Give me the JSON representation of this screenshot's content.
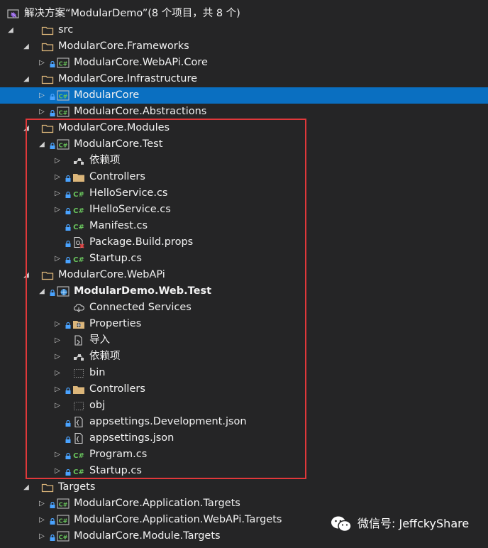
{
  "tree": {
    "items": [
      {
        "label": "解决方案“ModularDemo”(8 个项目，共 8 个)",
        "icon": "solution-icon",
        "arrow": "none",
        "depth": 0
      },
      {
        "label": "src",
        "icon": "folder-outline-icon",
        "arrow": "expanded",
        "depth": 1
      },
      {
        "label": "ModularCore.Frameworks",
        "icon": "folder-outline-icon",
        "arrow": "expanded",
        "depth": 2
      },
      {
        "label": "ModularCore.WebAPi.Core",
        "icon": "csharp-project-icon",
        "arrow": "collapsed",
        "depth": 3,
        "lock": true
      },
      {
        "label": "ModularCore.Infrastructure",
        "icon": "folder-outline-icon",
        "arrow": "expanded",
        "depth": 2
      },
      {
        "label": "ModularCore",
        "icon": "csharp-project-icon",
        "arrow": "collapsed",
        "depth": 3,
        "lock": true,
        "selected": true
      },
      {
        "label": "ModularCore.Abstractions",
        "icon": "csharp-project-icon",
        "arrow": "collapsed",
        "depth": 3,
        "lock": true
      },
      {
        "label": "ModularCore.Modules",
        "icon": "folder-outline-icon",
        "arrow": "expanded",
        "depth": 2
      },
      {
        "label": "ModularCore.Test",
        "icon": "csharp-project-icon",
        "arrow": "expanded",
        "depth": 3,
        "lock": true
      },
      {
        "label": "依赖项",
        "icon": "dependencies-icon",
        "arrow": "collapsed",
        "depth": 4
      },
      {
        "label": "Controllers",
        "icon": "folder-icon",
        "arrow": "collapsed",
        "depth": 4,
        "lock": true
      },
      {
        "label": "HelloService.cs",
        "icon": "csharp-file-icon",
        "arrow": "collapsed",
        "depth": 4,
        "lock": true
      },
      {
        "label": "IHelloService.cs",
        "icon": "csharp-file-icon",
        "arrow": "collapsed",
        "depth": 4,
        "lock": true
      },
      {
        "label": "Manifest.cs",
        "icon": "csharp-file-icon",
        "arrow": "none",
        "depth": 4,
        "lock": true
      },
      {
        "label": "Package.Build.props",
        "icon": "props-file-icon",
        "arrow": "none",
        "depth": 4,
        "lock": true
      },
      {
        "label": "Startup.cs",
        "icon": "csharp-file-icon",
        "arrow": "collapsed",
        "depth": 4,
        "lock": true
      },
      {
        "label": "ModularCore.WebAPi",
        "icon": "folder-outline-icon",
        "arrow": "expanded",
        "depth": 2
      },
      {
        "label": "ModularDemo.Web.Test",
        "icon": "web-project-icon",
        "arrow": "expanded",
        "depth": 3,
        "lock": true,
        "bold": true
      },
      {
        "label": "Connected Services",
        "icon": "connected-services-icon",
        "arrow": "none",
        "depth": 4
      },
      {
        "label": "Properties",
        "icon": "properties-folder-icon",
        "arrow": "collapsed",
        "depth": 4,
        "lock": true
      },
      {
        "label": "导入",
        "icon": "import-icon",
        "arrow": "collapsed",
        "depth": 4
      },
      {
        "label": "依赖项",
        "icon": "dependencies-icon",
        "arrow": "collapsed",
        "depth": 4
      },
      {
        "label": "bin",
        "icon": "dotted-folder-icon",
        "arrow": "collapsed",
        "depth": 4
      },
      {
        "label": "Controllers",
        "icon": "folder-icon",
        "arrow": "collapsed",
        "depth": 4,
        "lock": true
      },
      {
        "label": "obj",
        "icon": "dotted-folder-icon",
        "arrow": "collapsed",
        "depth": 4
      },
      {
        "label": "appsettings.Development.json",
        "icon": "json-file-icon",
        "arrow": "none",
        "depth": 4,
        "lock": true
      },
      {
        "label": "appsettings.json",
        "icon": "json-file-icon",
        "arrow": "none",
        "depth": 4,
        "lock": true
      },
      {
        "label": "Program.cs",
        "icon": "csharp-file-icon",
        "arrow": "collapsed",
        "depth": 4,
        "lock": true
      },
      {
        "label": "Startup.cs",
        "icon": "csharp-file-icon",
        "arrow": "collapsed",
        "depth": 4,
        "lock": true
      },
      {
        "label": "Targets",
        "icon": "folder-outline-icon",
        "arrow": "expanded",
        "depth": 2
      },
      {
        "label": "ModularCore.Application.Targets",
        "icon": "csharp-project-icon",
        "arrow": "collapsed",
        "depth": 3,
        "lock": true
      },
      {
        "label": "ModularCore.Application.WebAPi.Targets",
        "icon": "csharp-project-icon",
        "arrow": "collapsed",
        "depth": 3,
        "lock": true
      },
      {
        "label": "ModularCore.Module.Targets",
        "icon": "csharp-project-icon",
        "arrow": "collapsed",
        "depth": 3,
        "lock": true
      }
    ]
  },
  "watermark": {
    "text": "微信号: JeffckyShare",
    "icon": "wechat-icon"
  },
  "colors": {
    "background": "#252526",
    "selection": "#0a6fc1",
    "highlight_border": "#e0383a",
    "folder": "#dcb67a",
    "csharp": "#68c25c",
    "lock": "#4aa3ff"
  }
}
